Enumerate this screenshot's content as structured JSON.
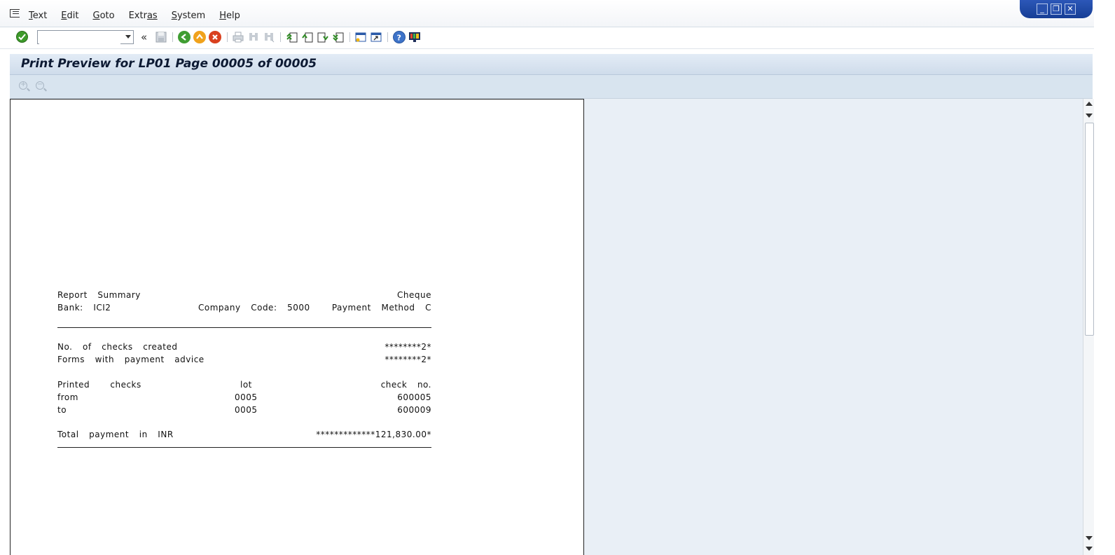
{
  "menu": {
    "items": [
      {
        "first": "T",
        "rest": "ext"
      },
      {
        "first": "E",
        "rest": "dit"
      },
      {
        "first": "G",
        "rest": "oto"
      },
      {
        "first": "Extr",
        "rest": "as",
        "underline_last": true
      },
      {
        "first": "S",
        "rest": "ystem"
      },
      {
        "first": "H",
        "rest": "elp"
      }
    ]
  },
  "window_controls": {
    "minimize": "_",
    "restore": "❐",
    "close": "✕"
  },
  "toolbar": {
    "command_field_value": "",
    "back_label": "«",
    "icons": [
      "enter-icon",
      "save-icon",
      "back-icon",
      "exit-icon",
      "cancel-icon",
      "print-icon",
      "find-icon",
      "find-next-icon",
      "first-page-icon",
      "previous-page-icon",
      "next-page-icon",
      "last-page-icon",
      "create-session-icon",
      "shortcut-icon",
      "help-icon",
      "layout-icon"
    ]
  },
  "title": "Print Preview for LP01 Page 00005 of 00005",
  "appbar": {
    "zoom_in": "+",
    "zoom_out": "−"
  },
  "report": {
    "title_left": "Report  Summary",
    "title_right": "Cheque",
    "bank_label": "Bank:  ICI2",
    "company_code": "Company  Code:  5000",
    "payment_method": "Payment  Method  C",
    "checks_created_label": "No.  of  checks  created",
    "checks_created_value": "********2*",
    "forms_label": "Forms  with  payment  advice",
    "forms_value": "********2*",
    "printed_checks_label": "Printed    checks",
    "lot_header": "lot",
    "check_no_header": "check  no.",
    "from_label": "from",
    "from_lot": "0005",
    "from_check": "600005",
    "to_label": "to",
    "to_lot": "0005",
    "to_check": "600009",
    "total_label": "Total  payment  in  INR",
    "total_value": "*************121,830.00*"
  },
  "colors": {
    "accent": "#1f4aa8",
    "title_bg": "#d5e1ee",
    "content_bg": "#e9eff6"
  }
}
